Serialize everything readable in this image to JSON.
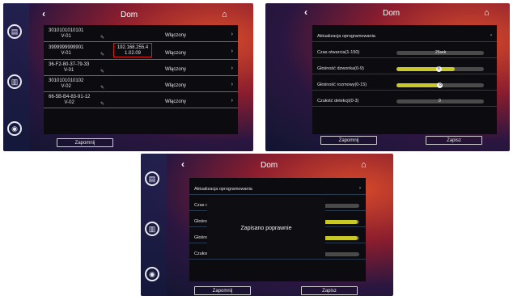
{
  "header": {
    "title": "Dom"
  },
  "panel1": {
    "rows": [
      {
        "ip_line1": "3010101010101",
        "ip_line2": "V-01",
        "state": "Włączony"
      },
      {
        "ip_line1": "3999999999901",
        "ip_line2": "V-01",
        "state": "Włączony"
      },
      {
        "ip_line1": "36-F2-80-37-79-33",
        "ip_line2": "V-01",
        "state": "Włączony"
      },
      {
        "ip_line1": "3010101010102",
        "ip_line2": "V-02",
        "state": "Włączony"
      },
      {
        "ip_line1": "66-5B-B4-83-91-12",
        "ip_line2": "V-02",
        "state": "Włączony"
      }
    ],
    "highlight": {
      "line1": "192.168.255.4",
      "line2": "1.02.09"
    },
    "forget_label": "Zapomnij"
  },
  "panel2": {
    "software_update": "Aktualizacja oprogramowania",
    "open_time": {
      "label": "Czas otwarcia(1-150)",
      "value": "25sek"
    },
    "bell_volume": {
      "label": "Głośność dzwonka(0-9)",
      "value": "6",
      "fraction": 0.67
    },
    "talk_volume": {
      "label": "Głośność rozmowy(0-15)",
      "value": "8",
      "fraction": 0.53
    },
    "sensitivity": {
      "label": "Czułość detekcji(0-3)",
      "value": "0"
    },
    "forget_label": "Zapomnij",
    "save_label": "Zapisz"
  },
  "panel3": {
    "software_update": "Aktualizacja oprogramowania",
    "row2_label": "Czas o",
    "row3_label": "Głośnc",
    "row4_label": "Głośnc",
    "row5_label": "Czułos",
    "dialog_text": "Zapisano poprawnie",
    "forget_label": "Zapomnij",
    "save_label": "Zapisz"
  },
  "icons": [
    "back-icon",
    "home-icon",
    "door-phone-icon",
    "monitor-icon",
    "camera-icon",
    "edit-icon",
    "chevron-right-icon"
  ],
  "colors": {
    "accent_line": "#2f7f8a",
    "slider_fill": "#c8c828",
    "highlight_border": "#d62020"
  }
}
